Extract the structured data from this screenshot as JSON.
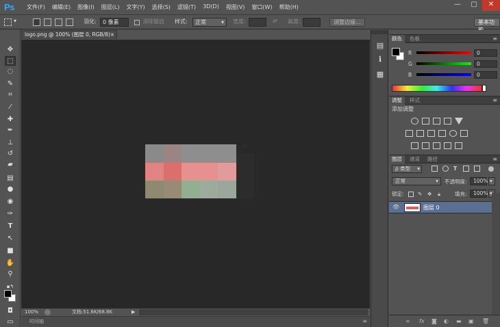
{
  "app": {
    "logo": "Ps"
  },
  "menu": [
    "文件(F)",
    "编辑(E)",
    "图像(I)",
    "图层(L)",
    "文字(Y)",
    "选择(S)",
    "滤镜(T)",
    "3D(D)",
    "视图(V)",
    "窗口(W)",
    "帮助(H)"
  ],
  "window_controls": {
    "minimize": "—",
    "restore": "▢",
    "close": "✕"
  },
  "options": {
    "feather_label": "羽化:",
    "feather_value": "0 像素",
    "antialias_label": "消除锯齿",
    "style_label": "样式:",
    "style_value": "正常",
    "width_label": "宽度:",
    "height_label": "高度:",
    "refine_edge_button": "调整边缘...",
    "workspace_button": "基本功能"
  },
  "document": {
    "tab_title": "logo.png @ 100% (图层 0, RGB/8)",
    "tab_close": "×",
    "zoom": "100%",
    "doc_size": "文档:51.6K/68.8K",
    "timeline_label": "时间轴"
  },
  "image_cells": [
    [
      "#8a8a8a",
      "#9b8484",
      "#8e8e8e",
      "#8e8e8e",
      "#8e8e8e"
    ],
    [
      "#e08383",
      "#dd6e6e",
      "#e69090",
      "#e69090",
      "#e39a9a"
    ],
    [
      "#8e8970",
      "#978b76",
      "#93ae90",
      "#9cab9c",
      "#9aa79a"
    ]
  ],
  "color_panel": {
    "tabs": [
      "颜色",
      "色板"
    ],
    "sliders": [
      {
        "label": "R",
        "value": "0",
        "color": "#cc3333"
      },
      {
        "label": "G",
        "value": "0",
        "color": "#33bb33"
      },
      {
        "label": "B",
        "value": "0",
        "color": "#3355cc"
      }
    ]
  },
  "adjustments_panel": {
    "tabs": [
      "调整",
      "样式"
    ],
    "title": "添加调整"
  },
  "layers_panel": {
    "tabs": [
      "图层",
      "通道",
      "路径"
    ],
    "filter_label": "ρ 类型",
    "blend_mode": "正常",
    "opacity_label": "不透明度:",
    "opacity_value": "100%",
    "lock_label": "锁定:",
    "fill_label": "填充:",
    "fill_value": "100%",
    "layers": [
      {
        "name": "图层 0"
      }
    ]
  },
  "colors": {
    "accent": "#31a8ff",
    "selected_layer": "#5a6f91",
    "canvas_bg": "#282828"
  }
}
